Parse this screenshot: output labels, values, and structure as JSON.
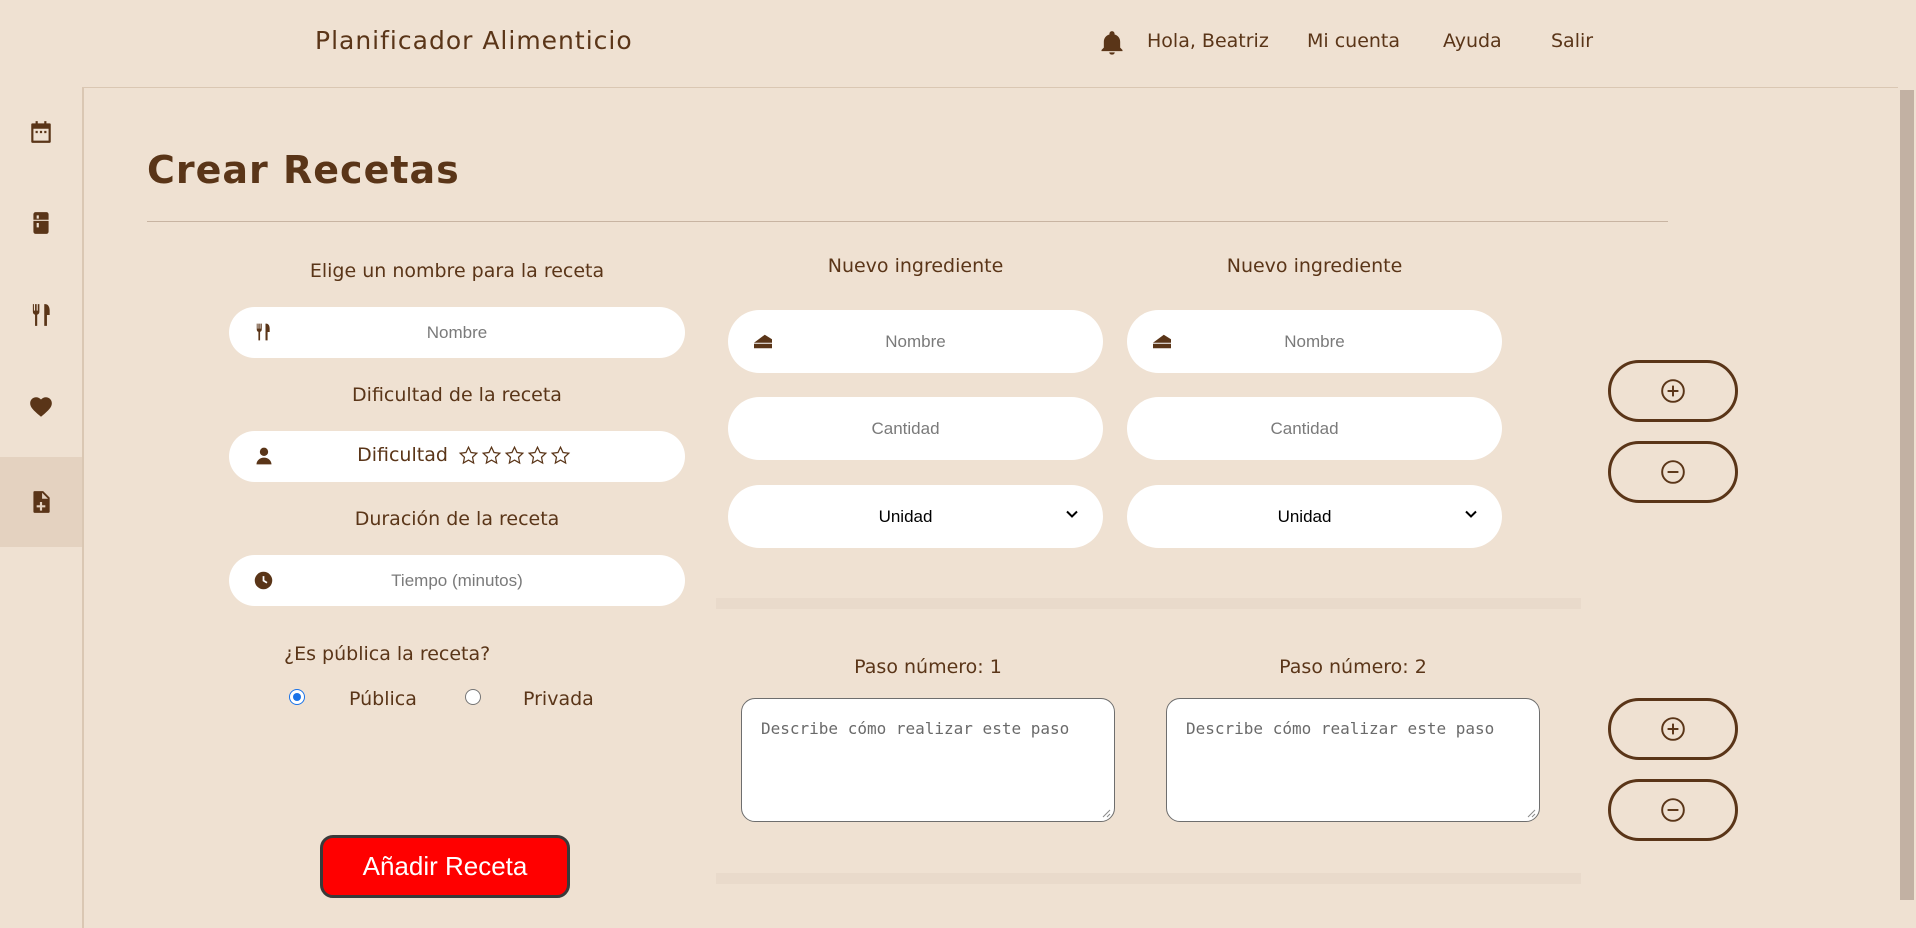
{
  "header": {
    "app_title": "Planificador Alimenticio",
    "greeting": "Hola, Beatriz",
    "links": [
      "Mi cuenta",
      "Ayuda",
      "Salir"
    ]
  },
  "sidebar": {
    "items": [
      {
        "icon": "calendar-icon",
        "active": false
      },
      {
        "icon": "fridge-icon",
        "active": false
      },
      {
        "icon": "utensils-icon",
        "active": false
      },
      {
        "icon": "heart-icon",
        "active": false
      },
      {
        "icon": "file-plus-icon",
        "active": true
      }
    ]
  },
  "page": {
    "title": "Crear Recetas"
  },
  "recipe": {
    "name_label": "Elige un nombre para la receta",
    "name_placeholder": "Nombre",
    "difficulty_label": "Dificultad de la receta",
    "difficulty_text": "Dificultad",
    "difficulty_stars": 5,
    "difficulty_value": 0,
    "duration_label": "Duración de la receta",
    "duration_placeholder": "Tiempo (minutos)",
    "public_label": "¿Es pública la receta?",
    "public_option": "Pública",
    "private_option": "Privada",
    "selected_visibility": "Pública",
    "submit_label": "Añadir Receta"
  },
  "ingredients": [
    {
      "title": "Nuevo ingrediente",
      "name_placeholder": "Nombre",
      "quantity_placeholder": "Cantidad",
      "unit_value": "Unidad"
    },
    {
      "title": "Nuevo ingrediente",
      "name_placeholder": "Nombre",
      "quantity_placeholder": "Cantidad",
      "unit_value": "Unidad"
    }
  ],
  "steps": [
    {
      "title": "Paso número: 1",
      "placeholder": "Describe cómo realizar este paso"
    },
    {
      "title": "Paso número: 2",
      "placeholder": "Describe cómo realizar este paso"
    }
  ],
  "colors": {
    "background": "#efe1d2",
    "text": "#5a3518",
    "submit": "#ff0000",
    "active_sidebar": "#e4d2c0"
  }
}
